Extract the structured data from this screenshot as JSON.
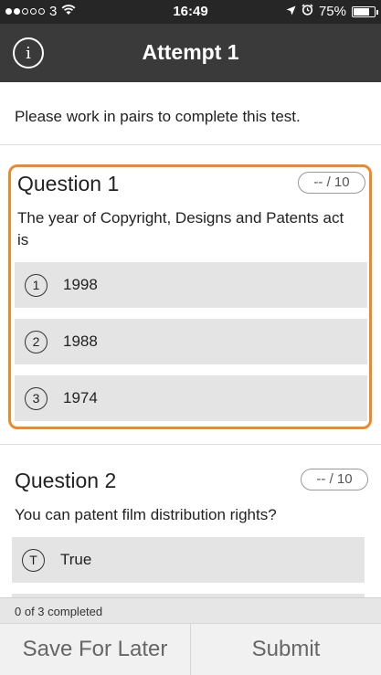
{
  "status_bar": {
    "carrier": "3",
    "time": "16:49",
    "battery": "75%",
    "battery_level": 0.75
  },
  "header": {
    "info_label": "i",
    "title": "Attempt 1"
  },
  "instructions": "Please work in pairs to complete this test.",
  "questions": [
    {
      "title": "Question 1",
      "score": "-- / 10",
      "text": "The year of Copyright, Designs and Patents act is",
      "options": [
        {
          "marker": "1",
          "label": "1998"
        },
        {
          "marker": "2",
          "label": "1988"
        },
        {
          "marker": "3",
          "label": "1974"
        }
      ]
    },
    {
      "title": "Question 2",
      "score": "-- / 10",
      "text": "You can patent film distribution rights?",
      "options": [
        {
          "marker": "T",
          "label": "True"
        }
      ]
    }
  ],
  "progress": "0 of 3 completed",
  "footer": {
    "save_label": "Save For Later",
    "submit_label": "Submit"
  },
  "colors": {
    "accent": "#f0882a",
    "header": "#3a3a3a",
    "status_bar": "#262626",
    "option_bg": "#e4e4e4"
  }
}
